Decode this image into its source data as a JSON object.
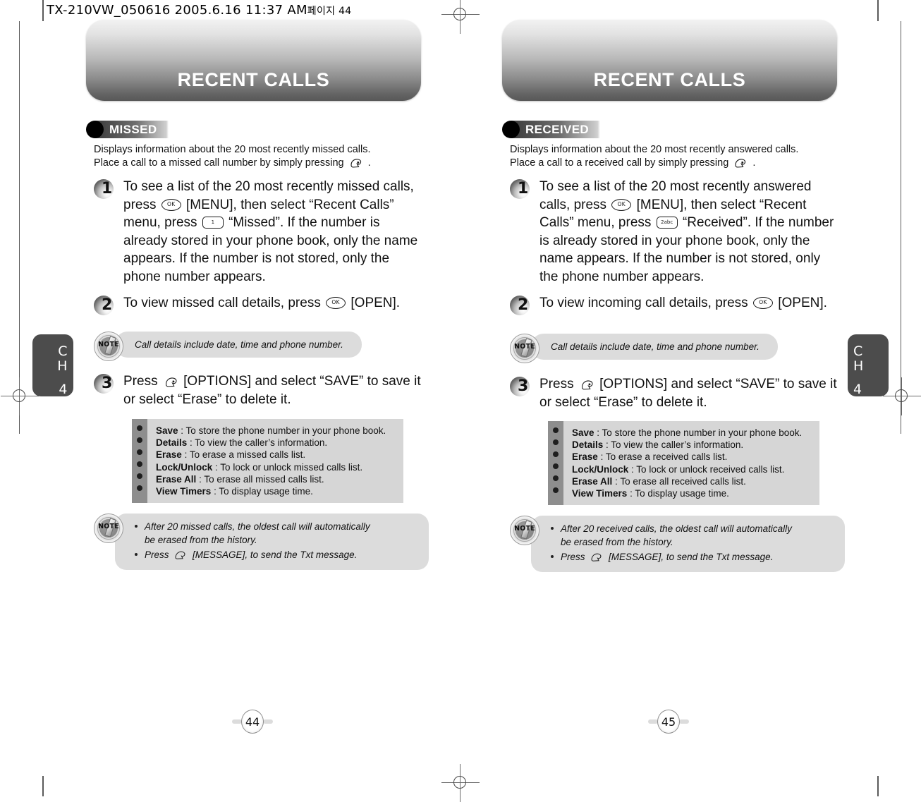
{
  "slug": {
    "text": "TX-210VW_050616  2005.6.16 11:37 AM",
    "korean": "페이지 44"
  },
  "pages": [
    {
      "banner_title": "RECENT CALLS",
      "section_tag": "MISSED",
      "intro": "Displays information about the 20 most recently missed calls. Place a call to a missed call number by simply pressing",
      "intro_line1": "Displays information about the 20 most recently missed calls.",
      "intro_line2_pre": "Place a call to a missed call number by simply pressing",
      "intro_line2_post": ".",
      "steps": [
        {
          "num": "1",
          "parts": {
            "a": "To see a list of the 20 most recently missed calls, press",
            "key1": "OK",
            "b": "[MENU], then select “Recent Calls” menu, press",
            "key2": "1",
            "c": "“Missed”. If the number is already stored in your phone book, only the name appears. If the number is not stored, only the phone number appears."
          }
        },
        {
          "num": "2",
          "parts": {
            "a": "To view missed call details, press",
            "key1": "OK",
            "b": "[OPEN]."
          }
        },
        {
          "num": "3",
          "parts": {
            "a": "Press",
            "key1": "send",
            "b": "[OPTIONS] and select “SAVE” to save it or select “Erase” to delete it."
          }
        }
      ],
      "note_small": "Call details include date, time and phone number.",
      "options": [
        {
          "term": "Save",
          "desc": ": To store the phone number in your phone book."
        },
        {
          "term": "Details",
          "desc": ": To view the caller’s information."
        },
        {
          "term": "Erase",
          "desc": ": To erase a missed calls list."
        },
        {
          "term": "Lock/Unlock",
          "desc": ": To lock or unlock missed calls list."
        },
        {
          "term": "Erase All",
          "desc": ": To erase all missed calls list."
        },
        {
          "term": "View Timers",
          "desc": ": To display usage time."
        }
      ],
      "note_bottom": {
        "item1_line1": "After 20 missed calls, the oldest call will automatically",
        "item1_line2": "be erased from the history.",
        "item2_pre": "Press",
        "item2_post": "[MESSAGE], to send the Txt message."
      },
      "chapter": {
        "ch": "C",
        "h": "H",
        "num": "4"
      },
      "page_number": "44"
    },
    {
      "banner_title": "RECENT CALLS",
      "section_tag": "RECEIVED",
      "intro_line1": "Displays information about the 20 most recently answered calls.",
      "intro_line2_pre": "Place a call to a received call by simply pressing",
      "intro_line2_post": ".",
      "steps": [
        {
          "num": "1",
          "parts": {
            "a": "To see a list of the 20 most recently answered calls, press",
            "key1": "OK",
            "b": "[MENU], then select “Recent Calls” menu, press",
            "key2": "2abc",
            "c": "“Received”. If the number is already stored in your phone book, only the name appears. If the number is not stored, only the phone number appears."
          }
        },
        {
          "num": "2",
          "parts": {
            "a": "To view incoming call details, press",
            "key1": "OK",
            "b": "[OPEN]."
          }
        },
        {
          "num": "3",
          "parts": {
            "a": "Press",
            "key1": "send",
            "b": "[OPTIONS] and select “SAVE” to save it or select “Erase” to delete it."
          }
        }
      ],
      "note_small": "Call details include date, time and phone number.",
      "options": [
        {
          "term": "Save",
          "desc": ": To store the phone number in your phone book."
        },
        {
          "term": "Details",
          "desc": ": To view the caller’s information."
        },
        {
          "term": "Erase",
          "desc": ": To erase a received calls list."
        },
        {
          "term": "Lock/Unlock",
          "desc": ": To lock or unlock received calls list."
        },
        {
          "term": "Erase All",
          "desc": ": To erase all received calls list."
        },
        {
          "term": "View Timers",
          "desc": ": To display usage time."
        }
      ],
      "note_bottom": {
        "item1_line1": "After 20 received calls, the oldest call will automatically",
        "item1_line2": "be erased from the history.",
        "item2_pre": "Press",
        "item2_post": "[MESSAGE], to send the Txt message."
      },
      "chapter": {
        "ch": "C",
        "h": "H",
        "num": "4"
      },
      "page_number": "45"
    }
  ],
  "note_icon_label": "NOTE",
  "colors": {
    "banner_top": "#f2f2f2",
    "banner_bottom": "#585858",
    "tag_dark": "#3b3b3b",
    "note_bg": "#dcdcdc",
    "options_bg": "#d6d6d6",
    "options_rail": "#8e8e8e",
    "chapter_tab": "#4c4c4c"
  }
}
